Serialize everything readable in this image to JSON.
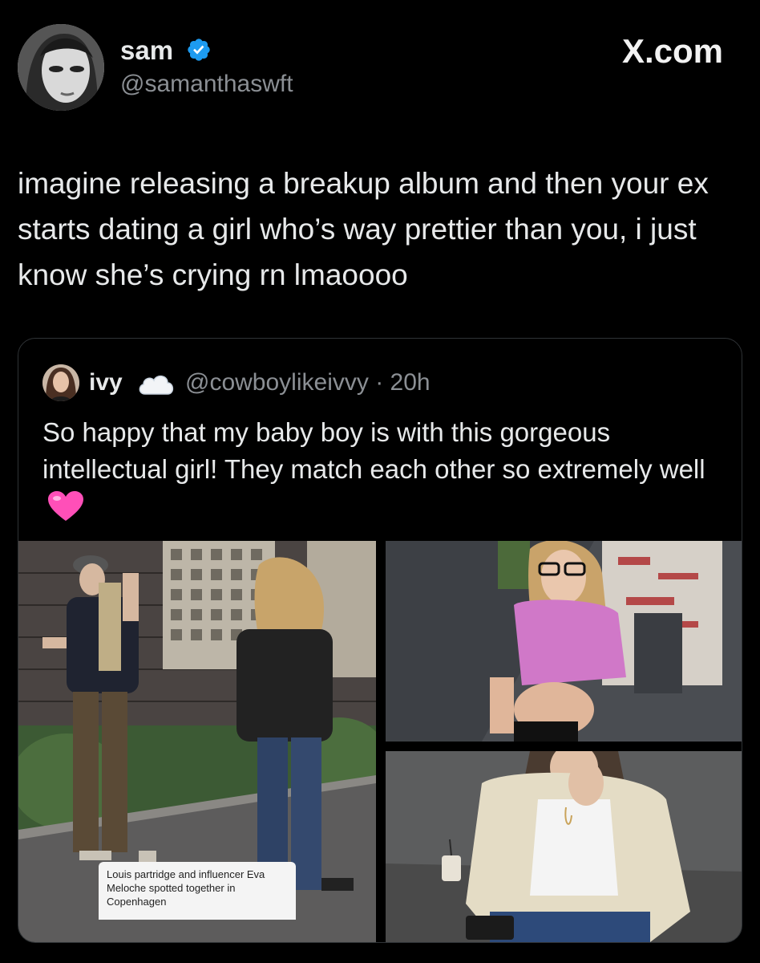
{
  "tweet": {
    "display_name": "sam",
    "handle": "@samanthaswft",
    "verified_icon": "verified-badge-icon",
    "site_label": "X.com",
    "text": "imagine releasing a breakup album and then your ex starts dating a girl who’s way prettier than you, i just know she’s crying rn lmaoooo"
  },
  "quote": {
    "display_name": "ivy",
    "name_emoji": "cloud-icon",
    "handle_time": "@cowboylikeivvy · 20h",
    "text": "So happy that my baby boy is with this gorgeous intellectual girl! They match each other so extremely well",
    "text_emoji": "pink-heart-icon",
    "media_caption": "Louis partridge and influencer Eva Meloche spotted together in Copenhagen"
  },
  "colors": {
    "background": "#000000",
    "text": "#e7e9ea",
    "secondary_text": "#8b8f94",
    "verified": "#1d9bf0",
    "border": "#2f3336"
  }
}
